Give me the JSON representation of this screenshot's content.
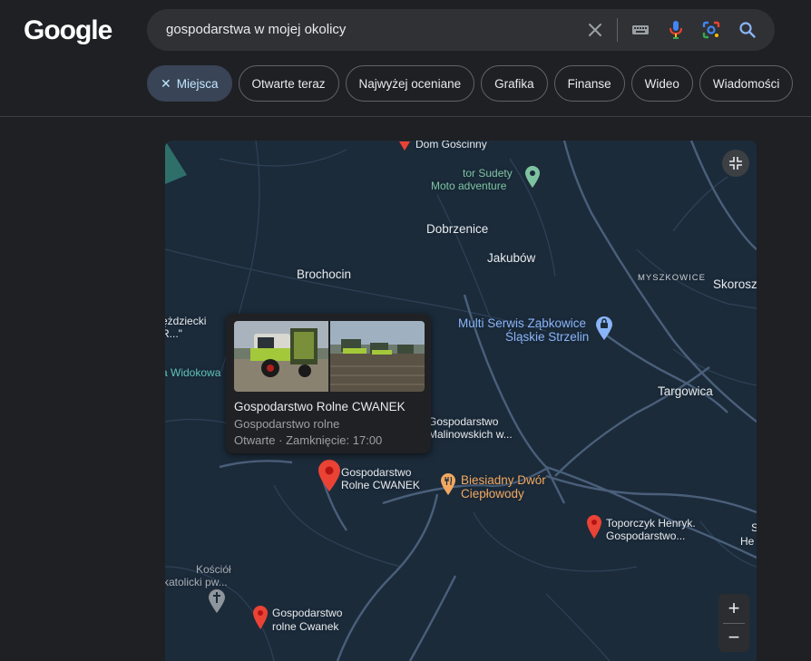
{
  "header": {
    "logo": "Google",
    "search": {
      "query": "gospodarstwa w mojej okolicy",
      "icons": [
        "clear-icon",
        "keyboard-icon",
        "microphone-icon",
        "lens-icon",
        "search-icon"
      ]
    }
  },
  "chips": [
    {
      "label": "Miejsca",
      "active": true
    },
    {
      "label": "Otwarte teraz"
    },
    {
      "label": "Najwyżej oceniane"
    },
    {
      "label": "Grafika"
    },
    {
      "label": "Finanse"
    },
    {
      "label": "Wideo"
    },
    {
      "label": "Wiadomości"
    }
  ],
  "map": {
    "places": {
      "dom_goscinny": "Dom Gościnny",
      "tor_sudety_1": "tor Sudety",
      "tor_sudety_2": "Moto adventure",
      "dobrzenice": "Dobrzenice",
      "jakubow": "Jakubów",
      "brochocin": "Brochocin",
      "myszkowice": "MYSZKOWICE",
      "skorosz": "Skorosz",
      "zdziecki_1": "ężdziecki",
      "zdziecki_2": "R...\"",
      "widokowa": "a Widokowa",
      "multi_serwis_1": "Multi Serwis Ząbkowice",
      "multi_serwis_2": "Śląskie Strzelin",
      "targowica": "Targowica",
      "gm_1": "Gospodarstwo",
      "gm_2": "Malinowskich w...",
      "cwanek_1": "Gospodarstwo",
      "cwanek_2": "Rolne CWANEK",
      "biesiadny_1": "Biesiadny Dwór",
      "biesiadny_2": "Ciepłowody",
      "toporczyk_1": "Toporczyk Henryk.",
      "toporczyk_2": "Gospodarstwo...",
      "he": "He",
      "s": "S",
      "kosciol_1": "Kościół",
      "kosciol_2": "katolicki pw...",
      "cwanek2_1": "Gospodarstwo",
      "cwanek2_2": "rolne Cwanek"
    },
    "popup": {
      "title": "Gospodarstwo Rolne CWANEK",
      "category": "Gospodarstwo rolne",
      "hours": "Otwarte · Zamknięcie: 17:00"
    },
    "controls": {
      "zoom_in": "+",
      "zoom_out": "−"
    }
  },
  "colors": {
    "background": "#1f2023",
    "map_background": "#1c2b3a",
    "pin_red": "#ea4335",
    "pin_green": "#7ec3a1",
    "pin_blue": "#8ab4f8",
    "pin_orange": "#f2a860",
    "chip_active": "#394457"
  }
}
